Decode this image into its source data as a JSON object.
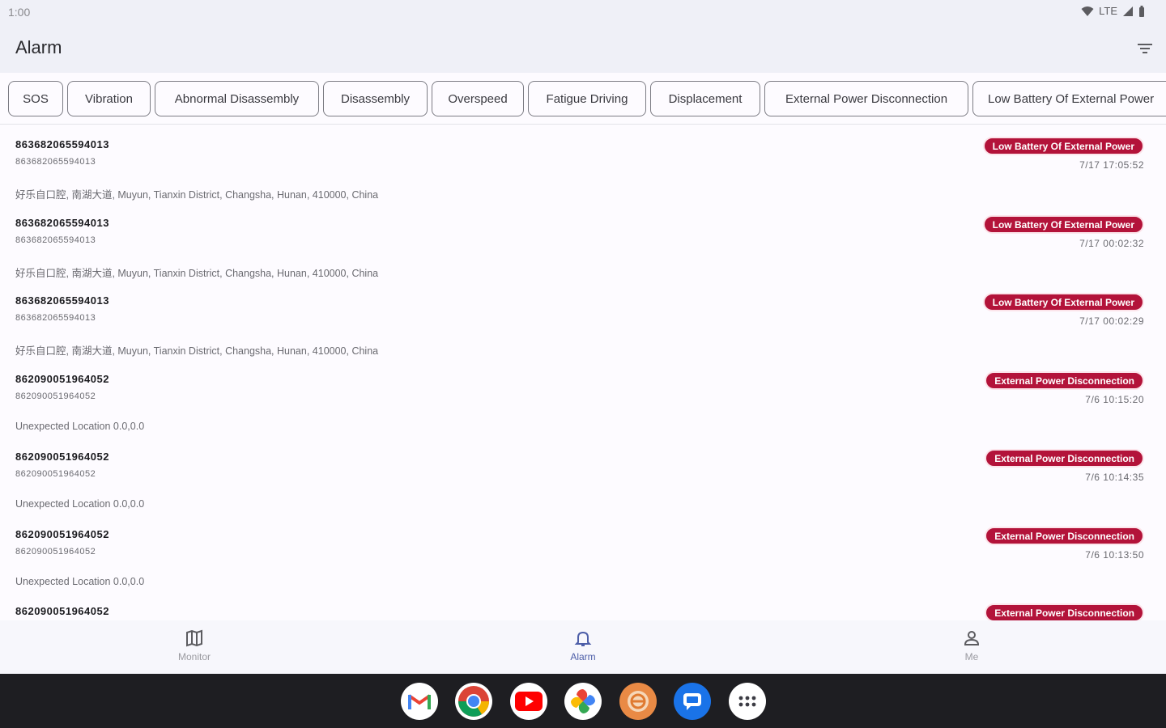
{
  "status": {
    "time": "1:00",
    "network": "LTE"
  },
  "appbar": {
    "title": "Alarm",
    "filter_icon": "filter-icon"
  },
  "chips": [
    "SOS",
    "Vibration",
    "Abnormal Disassembly",
    "Disassembly",
    "Overspeed",
    "Fatigue Driving",
    "Displacement",
    "External Power Disconnection",
    "Low Battery Of External Power"
  ],
  "alarms": [
    {
      "imei": "863682065594013",
      "sub": "863682065594013",
      "type": "Low Battery Of External Power",
      "time": "7/17 17:05:52",
      "address": "好乐自口腔, 南湖大道, Muyun, Tianxin District, Changsha, Hunan, 410000, China"
    },
    {
      "imei": "863682065594013",
      "sub": "863682065594013",
      "type": "Low Battery Of External Power",
      "time": "7/17 00:02:32",
      "address": "好乐自口腔, 南湖大道, Muyun, Tianxin District, Changsha, Hunan, 410000, China"
    },
    {
      "imei": "863682065594013",
      "sub": "863682065594013",
      "type": "Low Battery Of External Power",
      "time": "7/17 00:02:29",
      "address": "好乐自口腔, 南湖大道, Muyun, Tianxin District, Changsha, Hunan, 410000, China"
    },
    {
      "imei": "862090051964052",
      "sub": "862090051964052",
      "type": "External Power Disconnection",
      "time": "7/6 10:15:20",
      "address": "Unexpected Location 0.0,0.0"
    },
    {
      "imei": "862090051964052",
      "sub": "862090051964052",
      "type": "External Power Disconnection",
      "time": "7/6 10:14:35",
      "address": "Unexpected Location 0.0,0.0"
    },
    {
      "imei": "862090051964052",
      "sub": "862090051964052",
      "type": "External Power Disconnection",
      "time": "7/6 10:13:50",
      "address": "Unexpected Location 0.0,0.0"
    },
    {
      "imei": "862090051964052",
      "sub": "",
      "type": "External Power Disconnection",
      "time": "",
      "address": ""
    }
  ],
  "bottom_nav": [
    {
      "label": "Monitor",
      "icon": "map-icon",
      "active": false
    },
    {
      "label": "Alarm",
      "icon": "bell-icon",
      "active": true
    },
    {
      "label": "Me",
      "icon": "person-icon",
      "active": false
    }
  ],
  "taskbar_apps": [
    "gmail-icon",
    "chrome-icon",
    "youtube-icon",
    "photos-icon",
    "app-icon",
    "messages-icon",
    "app-drawer-icon"
  ],
  "colors": {
    "badge": "#b3133a",
    "accent": "#4d5ea8",
    "appbar": "#eff0f7"
  }
}
